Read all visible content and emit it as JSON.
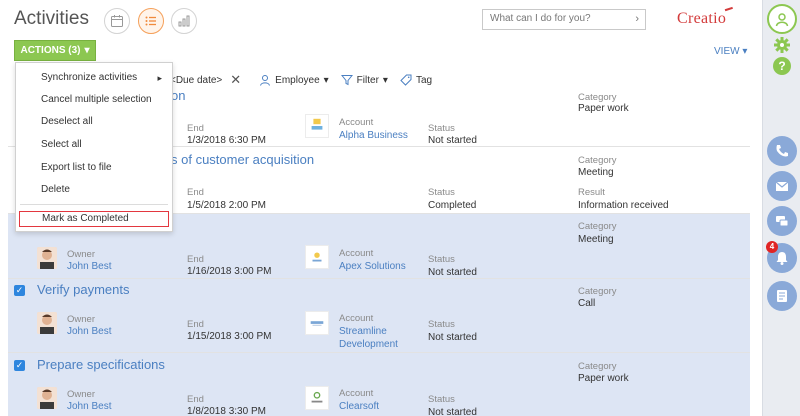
{
  "header": {
    "title": "Activities",
    "search_placeholder": "What can I do for you?",
    "logo": "Creatio",
    "actions_label": "ACTIONS (3)",
    "view_label": "VIEW"
  },
  "filters": {
    "due_date": "<Due date>",
    "employee": "Employee",
    "filter": "Filter",
    "tag": "Tag"
  },
  "actions_menu": {
    "items": [
      "Synchronize activities",
      "Cancel multiple selection",
      "Deselect all",
      "Select all",
      "Export list to file",
      "Delete"
    ],
    "mark_completed": "Mark as Completed"
  },
  "labels": {
    "owner": "Owner",
    "end": "End",
    "account": "Account",
    "status": "Status",
    "category": "Category",
    "result": "Result"
  },
  "rows": [
    {
      "title": "on",
      "end": "1/3/2018 6:30 PM",
      "account": "Alpha Business",
      "status": "Not started",
      "category": "Paper work"
    },
    {
      "title": "s of customer acquisition",
      "end": "1/5/2018 2:00 PM",
      "status": "Completed",
      "category": "Meeting",
      "result": "Information received"
    },
    {
      "owner": "John Best",
      "end": "1/16/2018 3:00 PM",
      "account": "Apex Solutions",
      "status": "Not started",
      "category": "Meeting"
    },
    {
      "title": "Verify payments",
      "owner": "John Best",
      "end": "1/15/2018 3:00 PM",
      "account_line1": "Streamline",
      "account_line2": "Development",
      "status": "Not started",
      "category": "Call"
    },
    {
      "title": "Prepare specifications",
      "owner": "John Best",
      "end": "1/8/2018 3:30 PM",
      "account": "Clearsoft",
      "status": "Not started",
      "category": "Paper work"
    }
  ],
  "notifications": {
    "count": "4"
  },
  "colors": {
    "accent_green": "#8cc751",
    "link_blue": "#4a7fc1",
    "selected_row": "#dde5f4",
    "sidebar_button": "#8aa9d8",
    "badge_red": "#e02424"
  }
}
